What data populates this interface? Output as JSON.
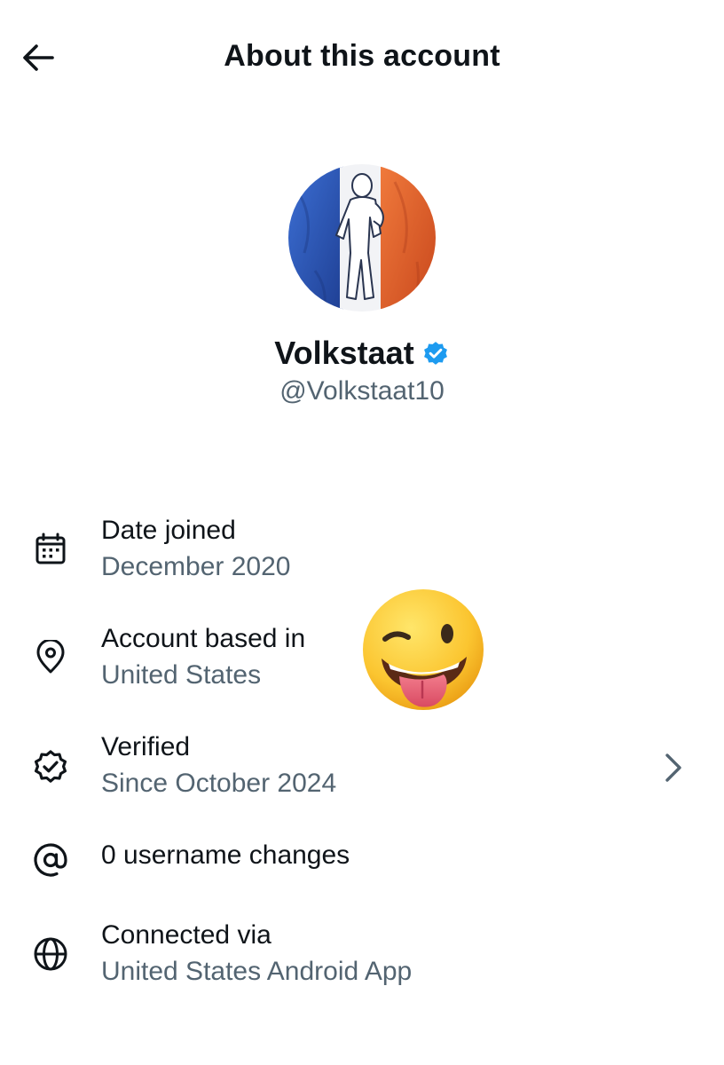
{
  "header": {
    "title": "About this account",
    "back_icon": "arrow-left-icon"
  },
  "profile": {
    "display_name": "Volkstaat",
    "handle": "@Volkstaat10",
    "verified_badge_color": "#1d9bf0"
  },
  "info_rows": [
    {
      "icon": "calendar-icon",
      "title": "Date joined",
      "value": "December 2020"
    },
    {
      "icon": "location-pin-icon",
      "title": "Account based in",
      "value": "United States"
    },
    {
      "icon": "verified-badge-icon",
      "title": "Verified",
      "value": "Since October 2024",
      "has_chevron": true
    },
    {
      "icon": "at-sign-icon",
      "title": "0 username changes"
    },
    {
      "icon": "globe-icon",
      "title": "Connected via",
      "value": "United States Android App"
    }
  ],
  "overlay": {
    "icon": "winking-tongue-emoji"
  },
  "colors": {
    "text_primary": "#0f1419",
    "text_secondary": "#536471",
    "accent": "#1d9bf0",
    "flag_blue": "#2b56b8",
    "flag_white": "#f4f4f6",
    "flag_orange": "#e8622a"
  }
}
